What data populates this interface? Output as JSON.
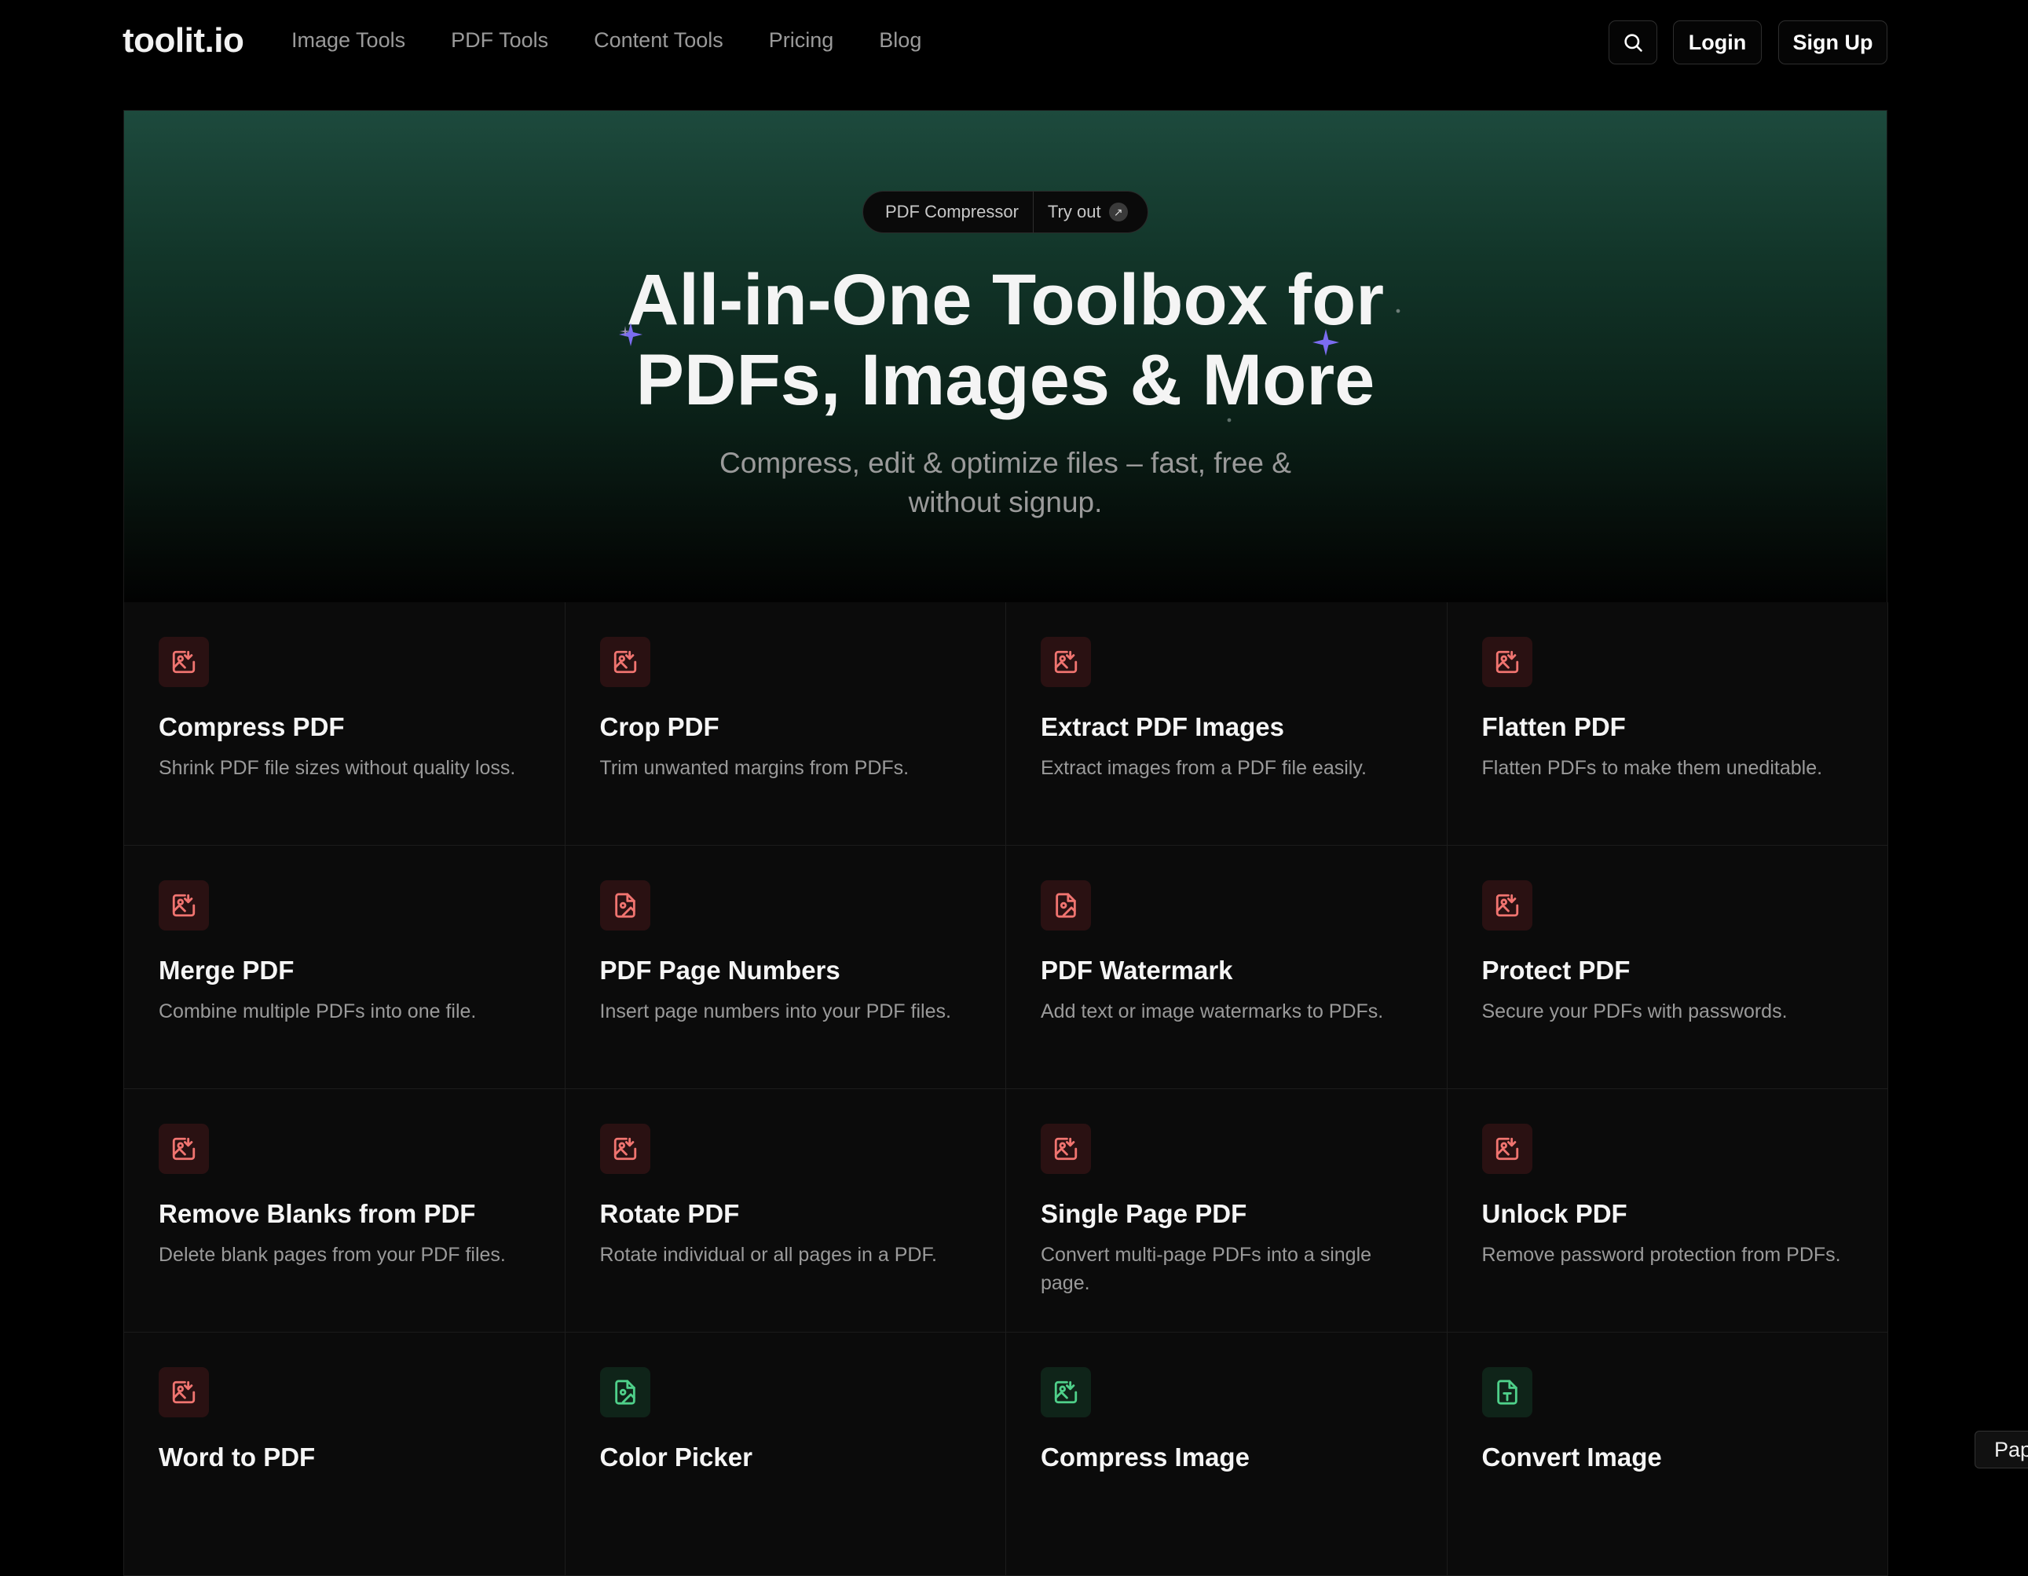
{
  "brand": {
    "logo": "toolit.io"
  },
  "nav": {
    "items": [
      "Image Tools",
      "PDF Tools",
      "Content Tools",
      "Pricing",
      "Blog"
    ]
  },
  "header": {
    "login": "Login",
    "signup": "Sign Up",
    "search_icon": "search-icon"
  },
  "hero": {
    "pill_label": "PDF Compressor",
    "pill_cta": "Try out",
    "title_line1": "All-in-One Toolbox for",
    "title_line2": "PDFs, Images & More",
    "subtitle_line1": "Compress, edit & optimize files – fast, free &",
    "subtitle_line2": "without signup.",
    "accent_color": "#7b6cf0"
  },
  "tools": [
    {
      "title": "Compress PDF",
      "desc": "Shrink PDF file sizes without quality loss.",
      "icon": "image-arrow-icon",
      "tone": "red"
    },
    {
      "title": "Crop PDF",
      "desc": "Trim unwanted margins from PDFs.",
      "icon": "image-arrow-icon",
      "tone": "red"
    },
    {
      "title": "Extract PDF Images",
      "desc": "Extract images from a PDF file easily.",
      "icon": "image-arrow-icon",
      "tone": "red"
    },
    {
      "title": "Flatten PDF",
      "desc": "Flatten PDFs to make them uneditable.",
      "icon": "image-arrow-icon",
      "tone": "red"
    },
    {
      "title": "Merge PDF",
      "desc": "Combine multiple PDFs into one file.",
      "icon": "image-arrow-icon",
      "tone": "red"
    },
    {
      "title": "PDF Page Numbers",
      "desc": "Insert page numbers into your PDF files.",
      "icon": "file-image-icon",
      "tone": "red"
    },
    {
      "title": "PDF Watermark",
      "desc": "Add text or image watermarks to PDFs.",
      "icon": "file-image-icon",
      "tone": "red"
    },
    {
      "title": "Protect PDF",
      "desc": "Secure your PDFs with passwords.",
      "icon": "image-arrow-icon",
      "tone": "red"
    },
    {
      "title": "Remove Blanks from PDF",
      "desc": "Delete blank pages from your PDF files.",
      "icon": "image-arrow-icon",
      "tone": "red"
    },
    {
      "title": "Rotate PDF",
      "desc": "Rotate individual or all pages in a PDF.",
      "icon": "image-arrow-icon",
      "tone": "red"
    },
    {
      "title": "Single Page PDF",
      "desc": "Convert multi-page PDFs into a single page.",
      "icon": "image-arrow-icon",
      "tone": "red"
    },
    {
      "title": "Unlock PDF",
      "desc": "Remove password protection from PDFs.",
      "icon": "image-arrow-icon",
      "tone": "red"
    },
    {
      "title": "Word to PDF",
      "desc": "",
      "icon": "image-arrow-icon",
      "tone": "red"
    },
    {
      "title": "Color Picker",
      "desc": "",
      "icon": "file-image-icon",
      "tone": "green"
    },
    {
      "title": "Compress Image",
      "desc": "",
      "icon": "image-arrow-icon",
      "tone": "green"
    },
    {
      "title": "Convert Image",
      "desc": "",
      "icon": "file-text-icon",
      "tone": "green"
    }
  ],
  "floating_tab": {
    "label": "Pap"
  }
}
